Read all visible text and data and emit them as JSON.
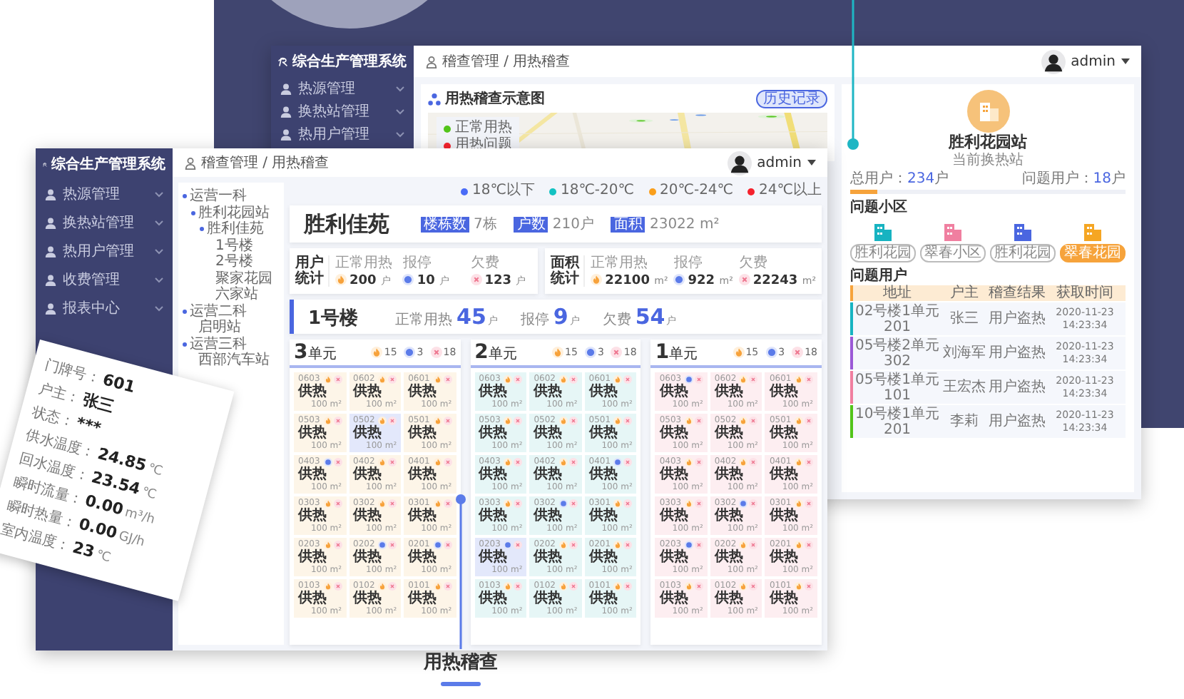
{
  "back_window": {
    "app_name": "综合生产管理系统",
    "nav": [
      {
        "label": "热源管理"
      },
      {
        "label": "换热站管理"
      },
      {
        "label": "热用户管理"
      }
    ],
    "breadcrumb": "稽查管理 / 用热稽查",
    "user": "admin",
    "map_panel": {
      "title": "用热稽查示意图",
      "button": "历史记录",
      "legend": [
        {
          "label": "正常用热",
          "color": "#52c41a"
        },
        {
          "label": "用热问题",
          "color": "#f5222d"
        }
      ]
    },
    "station": {
      "name": "胜利花园站",
      "subtitle": "当前换热站",
      "total": {
        "label": "总用户：",
        "value": "234",
        "unit": "户"
      },
      "problem": {
        "label": "问题用户：",
        "value": "18",
        "unit": "户"
      },
      "level": 0.1
    },
    "communities": {
      "title": "问题小区",
      "items": [
        {
          "label": "胜利花园",
          "color": "#17b3c1",
          "selected": false
        },
        {
          "label": "翠春小区",
          "color": "#f07fa0",
          "selected": false
        },
        {
          "label": "胜利花园",
          "color": "#4a66e0",
          "selected": false
        },
        {
          "label": "翠春花园",
          "color": "#f5a623",
          "selected": true
        }
      ]
    },
    "problem_users": {
      "title": "问题用户",
      "columns": [
        "地址",
        "户主",
        "稽查结果",
        "获取时间"
      ],
      "rows": [
        {
          "color": "#17b3c1",
          "cells": [
            "02号楼1单元201",
            "张三",
            "用户盗热",
            "2020-11-23 14:23:34"
          ]
        },
        {
          "color": "#9b59d6",
          "cells": [
            "05号楼2单元302",
            "刘海军",
            "用户盗热",
            "2020-11-23 14:23:34"
          ]
        },
        {
          "color": "#f07fa0",
          "cells": [
            "05号楼1单元101",
            "王宏杰",
            "用户盗热",
            "2020-11-23 14:23:34"
          ]
        },
        {
          "color": "#52c41a",
          "cells": [
            "10号楼1单元201",
            "李莉",
            "用户盗热",
            "2020-11-23 14:23:34"
          ]
        }
      ]
    }
  },
  "front_window": {
    "app_name": "综合生产管理系统",
    "nav": [
      {
        "label": "热源管理"
      },
      {
        "label": "换热站管理"
      },
      {
        "label": "热用户管理"
      },
      {
        "label": "收费管理"
      },
      {
        "label": "报表中心"
      }
    ],
    "breadcrumb": "稽查管理 / 用热稽查",
    "user": "admin",
    "tree": [
      {
        "label": "运营一科",
        "children": [
          {
            "label": "胜利花园站",
            "children": [
              {
                "label": "胜利佳苑",
                "children": [
                  {
                    "label": "1号楼"
                  },
                  {
                    "label": "2号楼"
                  },
                  {
                    "label": "聚家花园"
                  },
                  {
                    "label": "六家站"
                  }
                ]
              }
            ]
          }
        ]
      },
      {
        "label": "运营二科",
        "children": [
          {
            "label": "启明站"
          }
        ]
      },
      {
        "label": "运营三科",
        "children": [
          {
            "label": "西部汽车站"
          }
        ]
      }
    ],
    "legend": [
      {
        "label": "18℃以下",
        "color": "#4a6cf7"
      },
      {
        "label": "18℃-20℃",
        "color": "#13c2c2"
      },
      {
        "label": "20℃-24℃",
        "color": "#fa9f1b"
      },
      {
        "label": "24℃以上",
        "color": "#f5222d"
      }
    ],
    "community": {
      "name": "胜利佳苑",
      "tags": [
        {
          "label": "楼栋数",
          "value": "7栋"
        },
        {
          "label": "户数",
          "value": "210户"
        },
        {
          "label": "面积",
          "value": "23022 m²"
        }
      ]
    },
    "stats": [
      {
        "title": "用户统计",
        "items": [
          {
            "kind": "heating",
            "label": "正常用热",
            "value": "200",
            "unit": "户"
          },
          {
            "kind": "stopped",
            "label": "报停",
            "value": "10",
            "unit": "户"
          },
          {
            "kind": "arrears",
            "label": "欠费",
            "value": "123",
            "unit": "户"
          }
        ]
      },
      {
        "title": "面积统计",
        "items": [
          {
            "kind": "heating",
            "label": "正常用热",
            "value": "22100",
            "unit": "m²"
          },
          {
            "kind": "stopped",
            "label": "报停",
            "value": "922",
            "unit": "m²"
          },
          {
            "kind": "arrears",
            "label": "欠费",
            "value": "22243",
            "unit": "m²"
          }
        ]
      }
    ],
    "building": {
      "name": "1号楼",
      "items": [
        {
          "label": "正常用热",
          "value": "45",
          "unit": "户"
        },
        {
          "label": "报停",
          "value": "9",
          "unit": "户"
        },
        {
          "label": "欠费",
          "value": "54",
          "unit": "户"
        }
      ]
    },
    "units": [
      {
        "number": "3",
        "suffix": "单元",
        "color": "#fdf5e8",
        "counts": [
          {
            "kind": "heating",
            "value": "15"
          },
          {
            "kind": "stopped",
            "value": "3"
          },
          {
            "kind": "arrears",
            "value": "18"
          }
        ],
        "cells": [
          {
            "room": "0603",
            "kind": "heating",
            "label": "供热",
            "area": "100 m²",
            "selected": false
          },
          {
            "room": "0602",
            "kind": "heating",
            "label": "供热",
            "area": "100 m²",
            "selected": false
          },
          {
            "room": "0601",
            "kind": "heating",
            "label": "供热",
            "area": "100 m²",
            "selected": false
          },
          {
            "room": "0503",
            "kind": "heating",
            "label": "供热",
            "area": "100 m²",
            "selected": false
          },
          {
            "room": "0502",
            "kind": "heating",
            "label": "供热",
            "area": "100 m²",
            "selected": true
          },
          {
            "room": "0501",
            "kind": "heating",
            "label": "供热",
            "area": "100 m²",
            "selected": false
          },
          {
            "room": "0403",
            "kind": "stopped",
            "label": "供热",
            "area": "100 m²",
            "selected": false
          },
          {
            "room": "0402",
            "kind": "heating",
            "label": "供热",
            "area": "100 m²",
            "selected": false
          },
          {
            "room": "0401",
            "kind": "heating",
            "label": "供热",
            "area": "100 m²",
            "selected": false
          },
          {
            "room": "0303",
            "kind": "heating",
            "label": "供热",
            "area": "100 m²",
            "selected": false
          },
          {
            "room": "0302",
            "kind": "heating",
            "label": "供热",
            "area": "100 m²",
            "selected": false
          },
          {
            "room": "0301",
            "kind": "heating",
            "label": "供热",
            "area": "100 m²",
            "selected": false
          },
          {
            "room": "0203",
            "kind": "heating",
            "label": "供热",
            "area": "100 m²",
            "selected": false
          },
          {
            "room": "0202",
            "kind": "stopped",
            "label": "供热",
            "area": "100 m²",
            "selected": false
          },
          {
            "room": "0201",
            "kind": "stopped",
            "label": "供热",
            "area": "100 m²",
            "selected": false
          },
          {
            "room": "0103",
            "kind": "heating",
            "label": "供热",
            "area": "100 m²",
            "selected": false
          },
          {
            "room": "0102",
            "kind": "heating",
            "label": "供热",
            "area": "100 m²",
            "selected": false
          },
          {
            "room": "0101",
            "kind": "heating",
            "label": "供热",
            "area": "100 m²",
            "selected": false
          }
        ]
      },
      {
        "number": "2",
        "suffix": "单元",
        "color": "#e6f6f6",
        "counts": [
          {
            "kind": "heating",
            "value": "15"
          },
          {
            "kind": "stopped",
            "value": "3"
          },
          {
            "kind": "arrears",
            "value": "18"
          }
        ],
        "cells": [
          {
            "room": "0603",
            "kind": "heating",
            "label": "供热",
            "area": "100 m²",
            "selected": false
          },
          {
            "room": "0602",
            "kind": "heating",
            "label": "供热",
            "area": "100 m²",
            "selected": false
          },
          {
            "room": "0601",
            "kind": "heating",
            "label": "供热",
            "area": "100 m²",
            "selected": false
          },
          {
            "room": "0503",
            "kind": "heating",
            "label": "供热",
            "area": "100 m²",
            "selected": false
          },
          {
            "room": "0502",
            "kind": "heating",
            "label": "供热",
            "area": "100 m²",
            "selected": false
          },
          {
            "room": "0501",
            "kind": "heating",
            "label": "供热",
            "area": "100 m²",
            "selected": false
          },
          {
            "room": "0403",
            "kind": "heating",
            "label": "供热",
            "area": "100 m²",
            "selected": false
          },
          {
            "room": "0402",
            "kind": "heating",
            "label": "供热",
            "area": "100 m²",
            "selected": false
          },
          {
            "room": "0401",
            "kind": "stopped",
            "label": "供热",
            "area": "100 m²",
            "selected": false
          },
          {
            "room": "0303",
            "kind": "heating",
            "label": "供热",
            "area": "100 m²",
            "selected": false
          },
          {
            "room": "0302",
            "kind": "stopped",
            "label": "供热",
            "area": "100 m²",
            "selected": false
          },
          {
            "room": "0301",
            "kind": "heating",
            "label": "供热",
            "area": "100 m²",
            "selected": false
          },
          {
            "room": "0203",
            "kind": "stopped",
            "label": "供热",
            "area": "100 m²",
            "selected": true
          },
          {
            "room": "0202",
            "kind": "heating",
            "label": "供热",
            "area": "100 m²",
            "selected": false
          },
          {
            "room": "0201",
            "kind": "heating",
            "label": "供热",
            "area": "100 m²",
            "selected": false
          },
          {
            "room": "0103",
            "kind": "heating",
            "label": "供热",
            "area": "100 m²",
            "selected": false
          },
          {
            "room": "0102",
            "kind": "heating",
            "label": "供热",
            "area": "100 m²",
            "selected": false
          },
          {
            "room": "0101",
            "kind": "heating",
            "label": "供热",
            "area": "100 m²",
            "selected": false
          }
        ]
      },
      {
        "number": "1",
        "suffix": "单元",
        "color": "#fdeef1",
        "counts": [
          {
            "kind": "heating",
            "value": "15"
          },
          {
            "kind": "stopped",
            "value": "3"
          },
          {
            "kind": "arrears",
            "value": "18"
          }
        ],
        "cells": [
          {
            "room": "0603",
            "kind": "stopped",
            "label": "供热",
            "area": "100 m²",
            "selected": false
          },
          {
            "room": "0602",
            "kind": "heating",
            "label": "供热",
            "area": "100 m²",
            "selected": false
          },
          {
            "room": "0601",
            "kind": "heating",
            "label": "供热",
            "area": "100 m²",
            "selected": false
          },
          {
            "room": "0503",
            "kind": "heating",
            "label": "供热",
            "area": "100 m²",
            "selected": false
          },
          {
            "room": "0502",
            "kind": "heating",
            "label": "供热",
            "area": "100 m²",
            "selected": false
          },
          {
            "room": "0501",
            "kind": "heating",
            "label": "供热",
            "area": "100 m²",
            "selected": false
          },
          {
            "room": "0403",
            "kind": "heating",
            "label": "供热",
            "area": "100 m²",
            "selected": false
          },
          {
            "room": "0402",
            "kind": "heating",
            "label": "供热",
            "area": "100 m²",
            "selected": false
          },
          {
            "room": "0401",
            "kind": "heating",
            "label": "供热",
            "area": "100 m²",
            "selected": false
          },
          {
            "room": "0303",
            "kind": "heating",
            "label": "供热",
            "area": "100 m²",
            "selected": false
          },
          {
            "room": "0302",
            "kind": "stopped",
            "label": "供热",
            "area": "100 m²",
            "selected": false
          },
          {
            "room": "0301",
            "kind": "heating",
            "label": "供热",
            "area": "100 m²",
            "selected": false
          },
          {
            "room": "0203",
            "kind": "stopped",
            "label": "供热",
            "area": "100 m²",
            "selected": false
          },
          {
            "room": "0202",
            "kind": "heating",
            "label": "供热",
            "area": "100 m²",
            "selected": false
          },
          {
            "room": "0201",
            "kind": "heating",
            "label": "供热",
            "area": "100 m²",
            "selected": false
          },
          {
            "room": "0103",
            "kind": "heating",
            "label": "供热",
            "area": "100 m²",
            "selected": false
          },
          {
            "room": "0102",
            "kind": "heating",
            "label": "供热",
            "area": "100 m²",
            "selected": false
          },
          {
            "room": "0101",
            "kind": "heating",
            "label": "供热",
            "area": "100 m²",
            "selected": false
          }
        ]
      }
    ]
  },
  "detail_card": {
    "fields": [
      {
        "label": "门牌号：",
        "value": "601"
      },
      {
        "label": "户主：",
        "value": "张三"
      },
      {
        "label": "状态：",
        "value": "***"
      },
      {
        "label": "供水温度：",
        "value": "24.85",
        "unit": "℃"
      },
      {
        "label": "回水温度：",
        "value": "23.54",
        "unit": "℃"
      },
      {
        "label": "瞬时流量：",
        "value": "0.00",
        "unit": "m³/h"
      },
      {
        "label": "瞬时热量：",
        "value": "0.00",
        "unit": "GJ/h"
      },
      {
        "label": "室内温度：",
        "value": "23",
        "unit": "℃"
      }
    ]
  },
  "caption": "用热稽查"
}
